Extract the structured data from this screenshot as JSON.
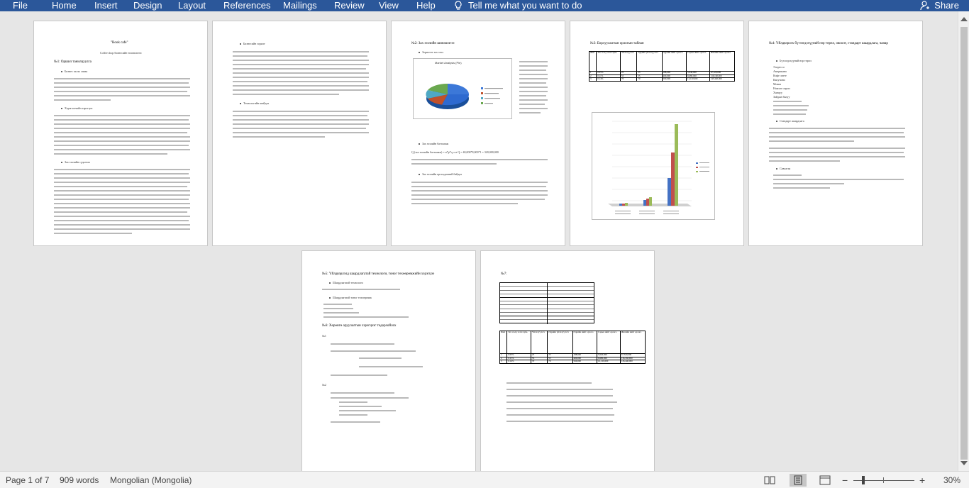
{
  "menu": {
    "file": "File",
    "tabs": [
      "Home",
      "Insert",
      "Design",
      "Layout",
      "References",
      "Mailings",
      "Review",
      "View",
      "Help"
    ],
    "tell_me": "Tell me what you want to do",
    "share": "Share"
  },
  "doc": {
    "p1": {
      "title": "\"Book cafe\"",
      "subtitle": "Coffee shop бизнесийн төлөвлөгөө",
      "section": "№1: Оршил танилцуулга",
      "bullet1": "Бизнес эхлэх санаа",
      "bullet2": "Хэрэглэгчийн хэрэгцээ",
      "bullet3": "Зах зээлийн судалгаа"
    },
    "p2": {
      "bullet1": "Бизнесийн зорилт",
      "bullet2": "Технологийн шийдэл"
    },
    "p3": {
      "section": "№2: Зах зээлийн шинжилгээ",
      "bullet1": "Зорилтот зах зээл",
      "chart_title": "Market Analysis (Pie)",
      "formula": "Q (зах зээлийн багтаамж) = n*p*q  ⟹  Q = 40,000*8,000*1 = 320,000,000",
      "bullet2": "Зах зээлийн багтаамж",
      "bullet3": "Зах зээлийн өрсөлдөөний байдал"
    },
    "p4": {
      "section": "№3: Борлуулалтын орлогын тайлан",
      "table_headers": [
        "Жил",
        "Зах зээлд эзлэх хувь",
        "Үйлчлүүлэгч",
        "Өдрийн үйлчлүүлэгч",
        "Өдрийн нийт орлого",
        "Сарын нийт орлого",
        "Жилийн нийт орлого"
      ],
      "table_rows": [
        [
          "1",
          "0.05%",
          "25",
          "25",
          "188,000",
          "5,640,000",
          "67,520,000"
        ],
        [
          "2",
          "0.11%",
          "55",
          "55",
          "400,000",
          "9,680,000",
          "116,160,000"
        ],
        [
          "3",
          "0.14%",
          "70",
          "70",
          "560,000",
          "12,120,000",
          "145,440,000"
        ]
      ]
    },
    "p5": {
      "section": "№4: Үйлдвэрлэх бүтээгдэхүүний нэр төрөл, овоолт, стандарт шаардлага, чанар",
      "sub1": "Бүтээгдэхүүний нэр төрөл",
      "items": [
        "Эспрессо",
        "Американо",
        "Кофе латте",
        "Капучино",
        "Мокка",
        "Нэмэлт сироп",
        "Ханцуу",
        "Зайдын бялуу"
      ],
      "sub2": "Стандарт шаардлага",
      "sub3": "Савлагаа"
    },
    "p6": {
      "section": "№5: Үйлдвэрлэлд шаардлагатай технологи, тоног төхөөрөмжийн хэрэгцээ",
      "bullet1": "Шаардлагатай технологи",
      "bullet2": "Шаардлагатай тоног төхөөрөмж",
      "section2": "№6: Хөрөнгө оруулалтын хэрэгцээг тодорхойлох",
      "n1": "№1",
      "n2": "№2"
    },
    "p7": {
      "section": "№7:"
    }
  },
  "status": {
    "page": "Page 1 of 7",
    "words": "909 words",
    "language": "Mongolian (Mongolia)",
    "zoom_minus": "−",
    "zoom_plus": "+",
    "zoom": "30%"
  },
  "colors": {
    "ribbon": "#2b579a",
    "status_bg": "#f3f3f3",
    "canvas": "#e6e6e6"
  }
}
